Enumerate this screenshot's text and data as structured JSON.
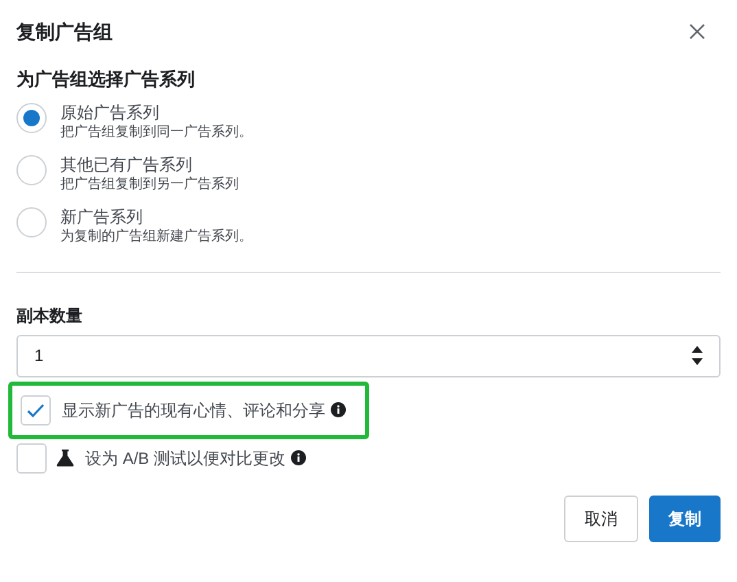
{
  "dialog": {
    "title": "复制广告组"
  },
  "section_label": "为广告组选择广告系列",
  "campaign_options": [
    {
      "label": "原始广告系列",
      "description": "把广告组复制到同一广告系列。",
      "selected": true
    },
    {
      "label": "其他已有广告系列",
      "description": "把广告组复制到另一广告系列",
      "selected": false
    },
    {
      "label": "新广告系列",
      "description": "为复制的广告组新建广告系列。",
      "selected": false
    }
  ],
  "copies": {
    "label": "副本数量",
    "value": "1"
  },
  "options": [
    {
      "kind": "plain",
      "label": "显示新广告的现有心情、评论和分享",
      "checked": true,
      "highlighted": true
    },
    {
      "kind": "test",
      "label": "设为 A/B 测试以便对比更改",
      "checked": false,
      "highlighted": false
    }
  ],
  "buttons": [
    {
      "kind": "secondary",
      "label": "取消"
    },
    {
      "kind": "primary",
      "label": "复制"
    }
  ]
}
